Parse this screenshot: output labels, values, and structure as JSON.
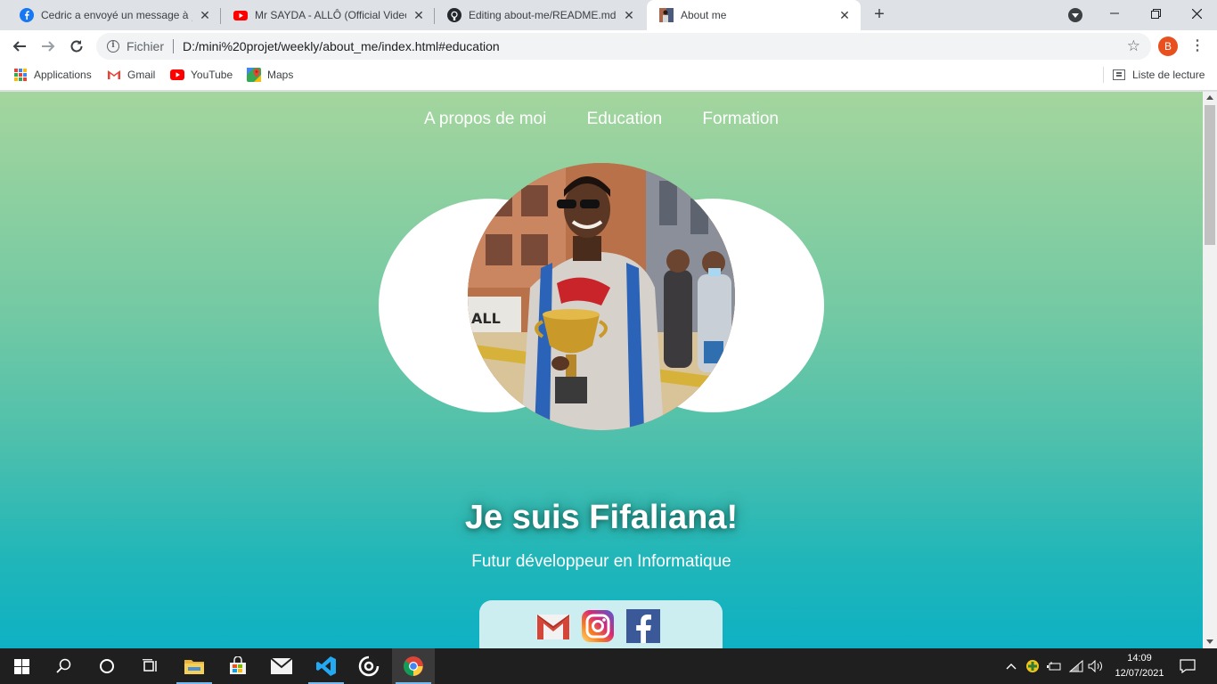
{
  "browser": {
    "tabs": [
      {
        "title": "Cedric a envoyé un message à 💻",
        "favicon": "facebook-icon"
      },
      {
        "title": "Mr SAYDA - ALLÔ (Official Video",
        "favicon": "youtube-icon"
      },
      {
        "title": "Editing about-me/README.md a",
        "favicon": "github-icon"
      },
      {
        "title": "About me",
        "favicon": "photo-favicon"
      }
    ],
    "active_tab": 3,
    "address": {
      "scheme": "Fichier",
      "url": "D:/mini%20projet/weekly/about_me/index.html#education"
    },
    "profile_initial": "B",
    "bookmarks": [
      {
        "label": "Applications",
        "icon": "apps-grid-icon"
      },
      {
        "label": "Gmail",
        "icon": "gmail-icon"
      },
      {
        "label": "YouTube",
        "icon": "youtube-icon"
      },
      {
        "label": "Maps",
        "icon": "maps-icon"
      }
    ],
    "reading_list": "Liste de lecture"
  },
  "page": {
    "nav": [
      "A propos de moi",
      "Education",
      "Formation"
    ],
    "title": "Je suis Fifaliana!",
    "subtitle": "Futur développeur en Informatique",
    "social": [
      "gmail-icon",
      "instagram-icon",
      "facebook-icon"
    ]
  },
  "taskbar": {
    "apps": [
      "file-explorer-icon",
      "microsoft-store-icon",
      "mail-icon",
      "vscode-icon",
      "media-player-icon",
      "chrome-icon"
    ],
    "time": "14:09",
    "date": "12/07/2021"
  },
  "colors": {
    "gradient_top": "#a4d59e",
    "gradient_bottom": "#0eb1c4",
    "tabstrip": "#dee1e6",
    "taskbar": "#1f1f1f",
    "profile": "#e8501f"
  }
}
